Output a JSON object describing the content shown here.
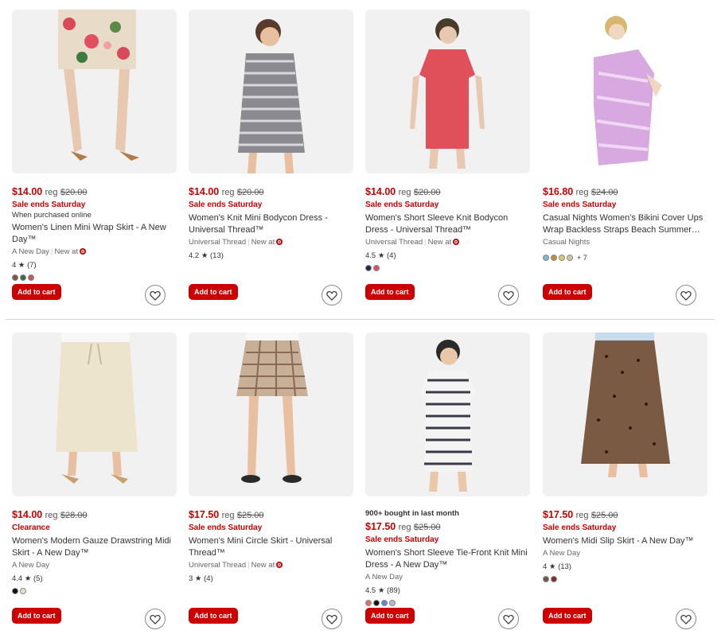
{
  "products": [
    {
      "price": "$14.00",
      "reg_label": "reg",
      "was": "$20.00",
      "promo": "Sale ends Saturday",
      "note": "When purchased online",
      "title": "Women's Linen Mini Wrap Skirt - A New Day™",
      "brand": "A New Day",
      "new_at": "New at",
      "rating": "4 ★ (7)",
      "swatches": [
        "#7a5a3a",
        "#3f6a4a",
        "#c85a4a"
      ]
    },
    {
      "price": "$14.00",
      "reg_label": "reg",
      "was": "$20.00",
      "promo": "Sale ends Saturday",
      "title": "Women's Knit Mini Bodycon Dress - Universal Thread™",
      "brand": "Universal Thread",
      "new_at": "New at",
      "rating": "4.2 ★ (13)"
    },
    {
      "price": "$14.00",
      "reg_label": "reg",
      "was": "$20.00",
      "promo": "Sale ends Saturday",
      "title": "Women's Short Sleeve Knit Bodycon Dress - Universal Thread™",
      "brand": "Universal Thread",
      "new_at": "New at",
      "rating": "4.5 ★ (4)",
      "swatches": [
        "#1f2a4a",
        "#e0505a"
      ]
    },
    {
      "price": "$16.80",
      "reg_label": "reg",
      "was": "$24.00",
      "promo": "Sale ends Saturday",
      "title": "Casual Nights Women's Bikini Cover Ups Wrap Backless Straps Beach Summer…",
      "brand": "Casual Nights",
      "swatches": [
        "#7ab8d8",
        "#c8902a",
        "#d8c870",
        "#c8c8a0"
      ],
      "more": "+ 7"
    },
    {
      "price": "$14.00",
      "reg_label": "reg",
      "was": "$28.00",
      "promo": "Clearance",
      "title": "Women's Modern Gauze Drawstring Midi Skirt - A New Day™",
      "brand": "A New Day",
      "rating": "4.4 ★ (5)",
      "swatches": [
        "#111111",
        "#e8e0c8"
      ]
    },
    {
      "price": "$17.50",
      "reg_label": "reg",
      "was": "$25.00",
      "promo": "Sale ends Saturday",
      "title": "Women's Mini Circle Skirt - Universal Thread™",
      "brand": "Universal Thread",
      "new_at": "New at",
      "rating": "3 ★ (4)"
    },
    {
      "bought": "900+ bought in last month",
      "price": "$17.50",
      "reg_label": "reg",
      "was": "$25.00",
      "promo": "Sale ends Saturday",
      "title": "Women's Short Sleeve Tie-Front Knit Mini Dress - A New Day™",
      "brand": "A New Day",
      "rating": "4.5 ★ (89)",
      "swatches": [
        "#e07070",
        "#111111",
        "#5a8ad8",
        "#b8b8c8"
      ]
    },
    {
      "price": "$17.50",
      "reg_label": "reg",
      "was": "$25.00",
      "promo": "Sale ends Saturday",
      "title": "Women's Midi Slip Skirt - A New Day™",
      "brand": "A New Day",
      "rating": "4 ★ (13)",
      "swatches": [
        "#6a5a4a",
        "#8a2a2a"
      ]
    }
  ],
  "add_to_cart_label": "Add to cart",
  "icons": {
    "favorite": "heart-icon",
    "store": "target-logo-icon"
  },
  "colors": {
    "accent": "#cc0000"
  }
}
